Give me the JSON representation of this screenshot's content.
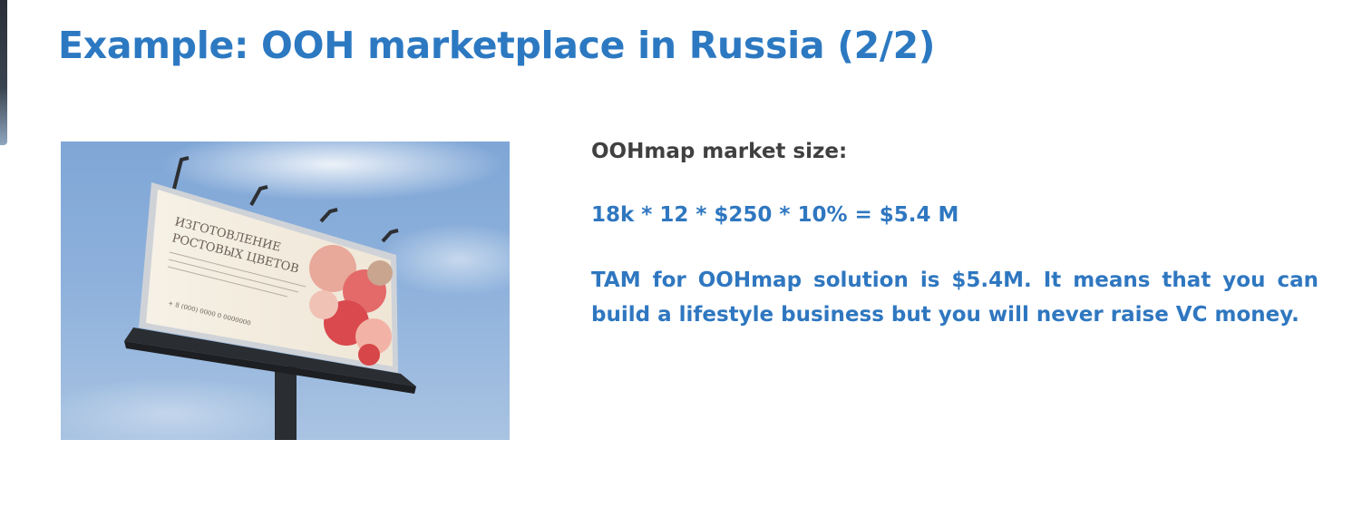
{
  "slide": {
    "title": "Example: OOH marketplace in Russia (2/2)",
    "image": {
      "icon": "billboard-photo",
      "billboard_text": [
        "ИЗГОТОВЛЕНИЕ",
        "РОСТОВЫХ ЦВЕТОВ"
      ],
      "billboard_phone": "+ 8 (000) 0000 0 0000000"
    },
    "market_heading": "OOHmap market size:",
    "formula": "18k * 12 * $250 * 10% = $5.4 M",
    "conclusion": "TAM for OOHmap solution is $5.4M. It means that you can build a lifestyle business but you will never raise VC money.",
    "colors": {
      "title": "#2c79c2",
      "accent_text": "#2f77c0",
      "heading_text": "#404040"
    }
  }
}
